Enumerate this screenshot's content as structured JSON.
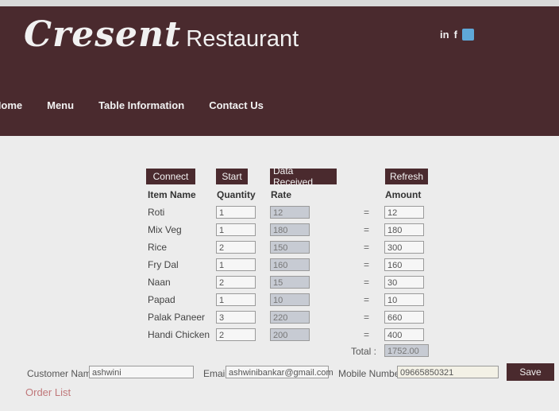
{
  "brand": {
    "script": "Cresent",
    "rest": "Restaurant"
  },
  "social": {
    "linkedin": "in",
    "facebook": "f",
    "twitter_icon": "twitter-icon"
  },
  "nav": [
    "Home",
    "Menu",
    "Table Information",
    "Contact Us"
  ],
  "buttons": {
    "connect": "Connect",
    "start": "Start",
    "data_received": "Data Received",
    "refresh": "Refresh",
    "save": "Save"
  },
  "columns": {
    "item": "Item Name",
    "qty": "Quantity",
    "rate": "Rate",
    "amount": "Amount"
  },
  "rows": [
    {
      "item": "Roti",
      "qty": "1",
      "rate": "12",
      "amount": "12"
    },
    {
      "item": "Mix Veg",
      "qty": "1",
      "rate": "180",
      "amount": "180"
    },
    {
      "item": "Rice",
      "qty": "2",
      "rate": "150",
      "amount": "300"
    },
    {
      "item": "Fry Dal",
      "qty": "1",
      "rate": "160",
      "amount": "160"
    },
    {
      "item": "Naan",
      "qty": "2",
      "rate": "15",
      "amount": "30"
    },
    {
      "item": "Papad",
      "qty": "1",
      "rate": "10",
      "amount": "10"
    },
    {
      "item": "Palak Paneer",
      "qty": "3",
      "rate": "220",
      "amount": "660"
    },
    {
      "item": "Handi Chicken",
      "qty": "2",
      "rate": "200",
      "amount": "400"
    }
  ],
  "equals_sign": "=",
  "total": {
    "label": "Total :",
    "value": "1752.00"
  },
  "customer": {
    "name_label": "Customer Name",
    "name_value": "ashwini",
    "email_label": "Email",
    "email_value": "ashwinibankar@gmail.com",
    "mobile_label": "Mobile Number",
    "mobile_value": "09665850321"
  },
  "order_list": "Order List"
}
